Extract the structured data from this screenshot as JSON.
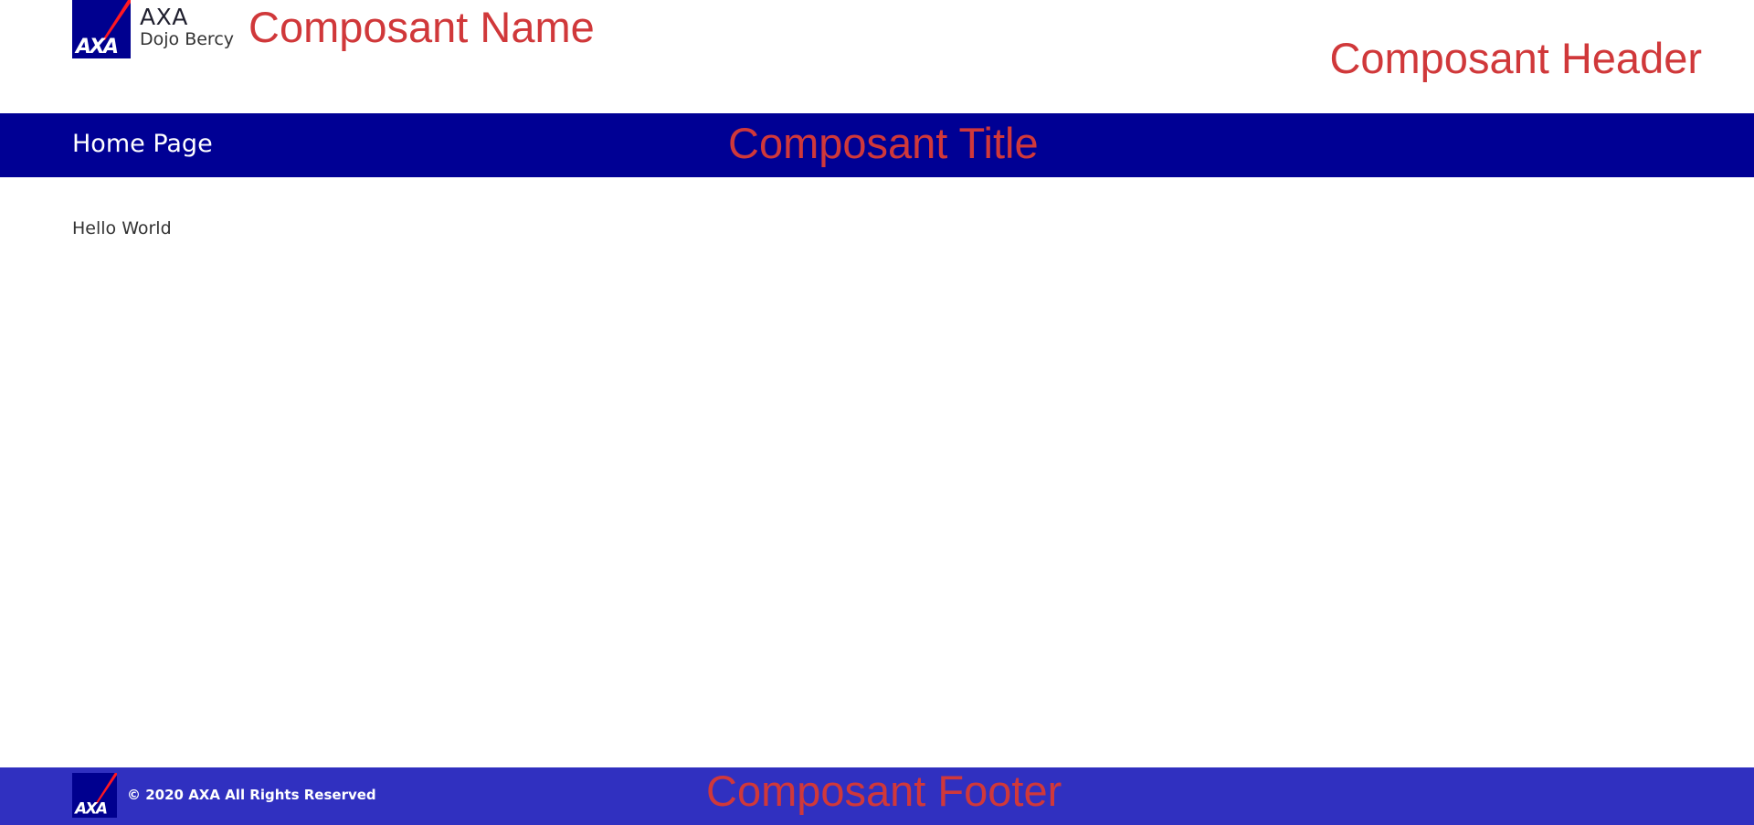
{
  "header": {
    "brand_name": "AXA",
    "brand_subtitle": "Dojo Bercy",
    "logo_icon": "axa-logo-icon",
    "annotation_name": "Composant Name",
    "annotation_header": "Composant Header"
  },
  "title_bar": {
    "label": "Home Page",
    "annotation": "Composant Title"
  },
  "content": {
    "text": "Hello World"
  },
  "footer": {
    "copyright": "© 2020 AXA All Rights Reserved",
    "logo_icon": "axa-logo-icon",
    "annotation": "Composant Footer"
  },
  "colors": {
    "brand_blue": "#00008f",
    "title_bar": "#000094",
    "footer": "#3030c0",
    "annotation_red": "#d0383a",
    "logo_red_slash": "#ff1721"
  }
}
